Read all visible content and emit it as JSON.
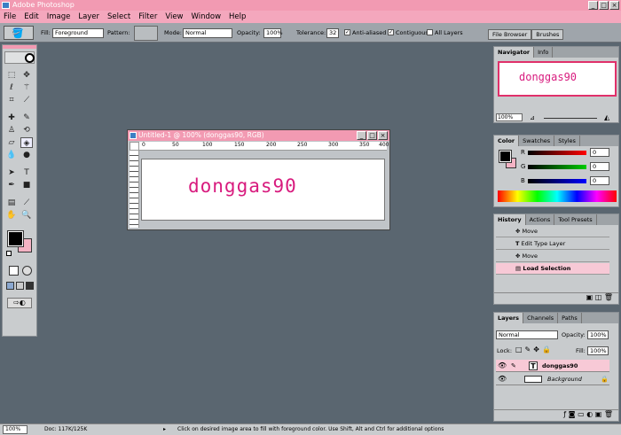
{
  "app": {
    "title": "Adobe Photoshop",
    "win_buttons": [
      "_",
      "□",
      "×"
    ]
  },
  "menu": [
    "File",
    "Edit",
    "Image",
    "Layer",
    "Select",
    "Filter",
    "View",
    "Window",
    "Help"
  ],
  "options": {
    "fill_label": "Fill:",
    "fill_value": "Foreground",
    "pattern_label": "Pattern:",
    "mode_label": "Mode:",
    "mode_value": "Normal",
    "opacity_label": "Opacity:",
    "opacity_value": "100%",
    "tolerance_label": "Tolerance:",
    "tolerance_value": "32",
    "anti_aliased": "Anti-aliased",
    "contiguous": "Contiguous",
    "all_layers": "All Layers",
    "palette_tabs": [
      "File Browser",
      "Brushes"
    ]
  },
  "document": {
    "title": "Untitled-1 @ 100% (donggas90, RGB)",
    "text": "donggas90",
    "ruler": [
      "0",
      "50",
      "100",
      "150",
      "200",
      "250",
      "300",
      "350",
      "400"
    ],
    "text_color": "#d81b7e"
  },
  "navigator": {
    "tabs": [
      "Navigator",
      "Info"
    ],
    "zoom": "100%"
  },
  "color": {
    "tabs": [
      "Color",
      "Swatches",
      "Styles"
    ],
    "channels": [
      {
        "label": "R",
        "value": "0"
      },
      {
        "label": "G",
        "value": "0"
      },
      {
        "label": "B",
        "value": "0"
      }
    ]
  },
  "history": {
    "tabs": [
      "History",
      "Actions",
      "Tool Presets"
    ],
    "items": [
      "Move",
      "Edit Type Layer",
      "Move",
      "Load Selection"
    ]
  },
  "layers": {
    "tabs": [
      "Layers",
      "Channels",
      "Paths"
    ],
    "mode": "Normal",
    "opacity_label": "Opacity:",
    "opacity": "100%",
    "lock_label": "Lock:",
    "fill_label": "Fill:",
    "fill": "100%",
    "items": [
      {
        "name": "donggas90",
        "type": "T"
      },
      {
        "name": "Background",
        "type": "img"
      }
    ]
  },
  "status": {
    "zoom": "100%",
    "doc": "Doc: 117K/125K",
    "hint": "Click on desired image area to fill with foreground color.  Use Shift, Alt and Ctrl for additional options"
  }
}
